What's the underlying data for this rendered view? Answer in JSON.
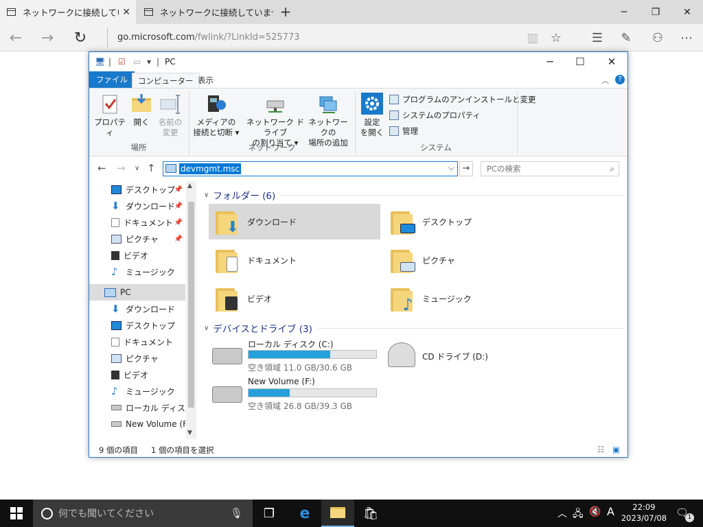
{
  "browser": {
    "tabs": [
      {
        "label": "ネットワークに接続していません"
      },
      {
        "label": "ネットワークに接続していません"
      }
    ],
    "new_tab": "+",
    "url_host": "go.microsoft.com",
    "url_path": "/fwlink/?LinkId=525773"
  },
  "explorer": {
    "title": "PC",
    "ribbon_tabs": {
      "file": "ファイル",
      "computer": "コンピューター",
      "view": "表示"
    },
    "ribbon": {
      "properties": "プロパティ",
      "open": "開く",
      "rename_1": "名前の",
      "rename_2": "変更",
      "group_location": "場所",
      "media_1": "メディアの",
      "media_2": "接続と切断",
      "mapdrive_1": "ネットワーク ドライブ",
      "mapdrive_2": "の割り当て",
      "netloc_1": "ネットワークの",
      "netloc_2": "場所の追加",
      "group_network": "ネットワーク",
      "settings_1": "設定",
      "settings_2": "を開く",
      "uninstall": "プログラムのアンインストールと変更",
      "sysprops": "システムのプロパティ",
      "manage": "管理",
      "group_system": "システム"
    },
    "address_value": "devmgmt.msc",
    "search_placeholder": "PCの検索",
    "nav": [
      {
        "label": "デスクトップ",
        "pinned": true
      },
      {
        "label": "ダウンロード",
        "pinned": true
      },
      {
        "label": "ドキュメント",
        "pinned": true
      },
      {
        "label": "ピクチャ",
        "pinned": true
      },
      {
        "label": "ビデオ"
      },
      {
        "label": "ミュージック"
      },
      {
        "label": "PC"
      },
      {
        "label": "ダウンロード"
      },
      {
        "label": "デスクトップ"
      },
      {
        "label": "ドキュメント"
      },
      {
        "label": "ピクチャ"
      },
      {
        "label": "ビデオ"
      },
      {
        "label": "ミュージック"
      },
      {
        "label": "ローカル ディスク (C:)"
      },
      {
        "label": "New Volume (F:)"
      }
    ],
    "folders_header": "フォルダー (6)",
    "folders": [
      {
        "label": "ダウンロード"
      },
      {
        "label": "デスクトップ"
      },
      {
        "label": "ドキュメント"
      },
      {
        "label": "ピクチャ"
      },
      {
        "label": "ビデオ"
      },
      {
        "label": "ミュージック"
      }
    ],
    "drives_header": "デバイスとドライブ (3)",
    "drives": [
      {
        "label": "ローカル ディスク (C:)",
        "free": "空き領域 11.0 GB/30.6 GB",
        "used_fraction": 0.64
      },
      {
        "label": "New Volume (F:)",
        "free": "空き領域 26.8 GB/39.3 GB",
        "used_fraction": 0.32
      },
      {
        "label": "CD ドライブ (D:)"
      }
    ],
    "status_count": "9 個の項目",
    "status_selected": "1 個の項目を選択"
  },
  "taskbar": {
    "search_placeholder": "何でも聞いてください",
    "time": "22:09",
    "date": "2023/07/08",
    "ime": "A",
    "notification_count": "1"
  },
  "colors": {
    "accent": "#1979ca",
    "selection": "#0078d7",
    "drive_fill": "#26a0da"
  }
}
